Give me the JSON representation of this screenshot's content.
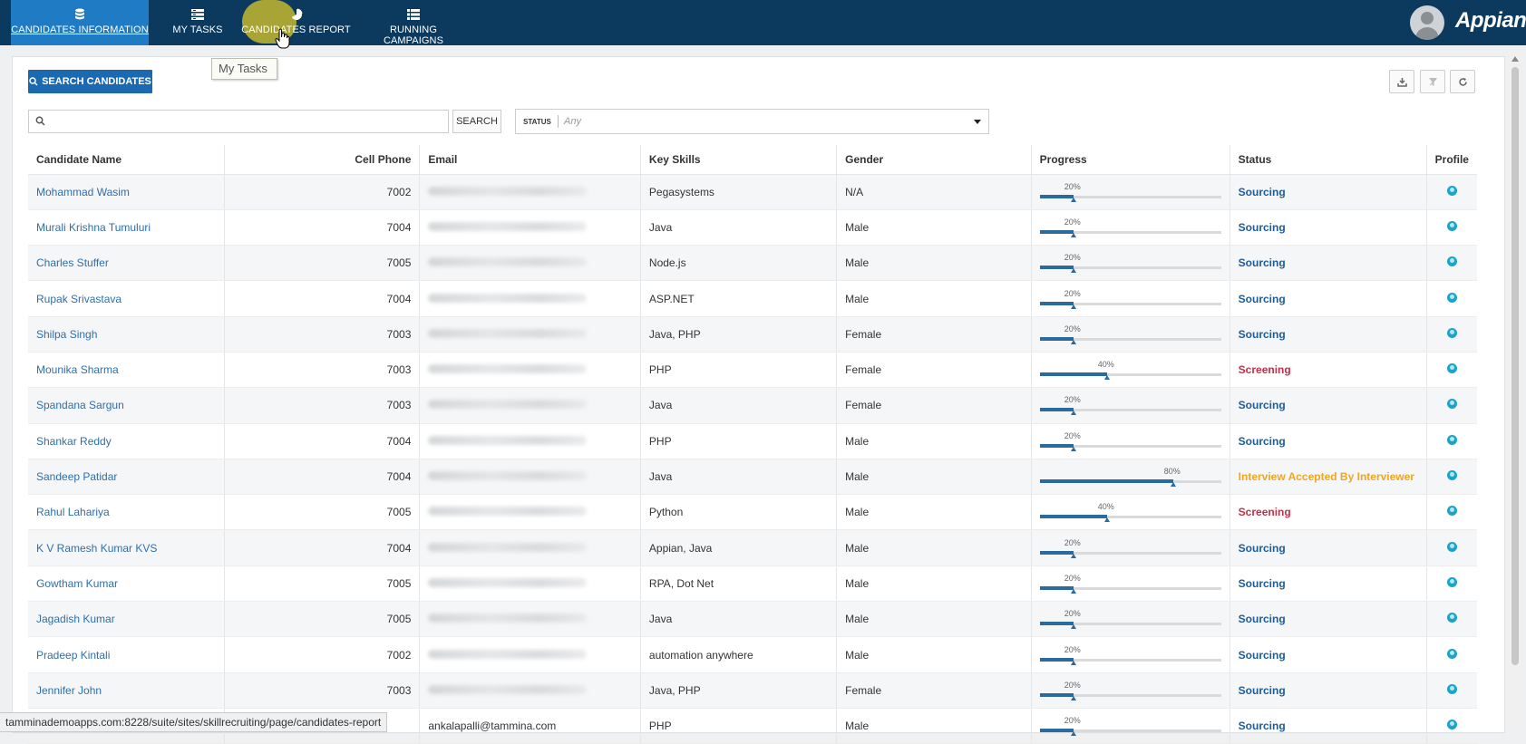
{
  "nav": {
    "tabs": [
      {
        "label": "CANDIDATES INFORMATION",
        "icon": "database-icon"
      },
      {
        "label": "MY TASKS",
        "icon": "tasks-icon"
      },
      {
        "label": "CANDIDATES REPORT",
        "icon": "pie-chart-icon"
      },
      {
        "label": "RUNNING CAMPAIGNS",
        "icon": "list-icon"
      }
    ],
    "brand": "Appian"
  },
  "tooltip": "My Tasks",
  "toolbar": {
    "search_candidates_label": "SEARCH CANDIDATES",
    "search_placeholder": "",
    "search_button_label": "SEARCH",
    "status_label": "STATUS",
    "status_value": "Any"
  },
  "table": {
    "headers": {
      "name": "Candidate Name",
      "phone": "Cell Phone",
      "email": "Email",
      "skills": "Key Skills",
      "gender": "Gender",
      "progress": "Progress",
      "status": "Status",
      "profile": "Profile"
    },
    "rows": [
      {
        "name": "Mohammad Wasim",
        "phone": "7002",
        "skills": "Pegasystems",
        "gender": "N/A",
        "progress": 20,
        "progress_label": "20%",
        "status": "Sourcing",
        "status_color": "#1d5c96"
      },
      {
        "name": "Murali Krishna Tumuluri",
        "phone": "7004",
        "skills": "Java",
        "gender": "Male",
        "progress": 20,
        "progress_label": "20%",
        "status": "Sourcing",
        "status_color": "#1d5c96"
      },
      {
        "name": "Charles Stuffer",
        "phone": "7005",
        "skills": "Node.js",
        "gender": "Male",
        "progress": 20,
        "progress_label": "20%",
        "status": "Sourcing",
        "status_color": "#1d5c96"
      },
      {
        "name": "Rupak Srivastava",
        "phone": "7004",
        "skills": "ASP.NET",
        "gender": "Male",
        "progress": 20,
        "progress_label": "20%",
        "status": "Sourcing",
        "status_color": "#1d5c96"
      },
      {
        "name": "Shilpa Singh",
        "phone": "7003",
        "skills": "Java, PHP",
        "gender": "Female",
        "progress": 20,
        "progress_label": "20%",
        "status": "Sourcing",
        "status_color": "#1d5c96"
      },
      {
        "name": "Mounika Sharma",
        "phone": "7003",
        "skills": "PHP",
        "gender": "Female",
        "progress": 40,
        "progress_label": "40%",
        "status": "Screening",
        "status_color": "#c2304a"
      },
      {
        "name": "Spandana Sargun",
        "phone": "7003",
        "skills": "Java",
        "gender": "Female",
        "progress": 20,
        "progress_label": "20%",
        "status": "Sourcing",
        "status_color": "#1d5c96"
      },
      {
        "name": "Shankar Reddy",
        "phone": "7004",
        "skills": "PHP",
        "gender": "Male",
        "progress": 20,
        "progress_label": "20%",
        "status": "Sourcing",
        "status_color": "#1d5c96"
      },
      {
        "name": "Sandeep Patidar",
        "phone": "7004",
        "skills": "Java",
        "gender": "Male",
        "progress": 80,
        "progress_label": "80%",
        "status": "Interview Accepted By Interviewer",
        "status_color": "#f0a524"
      },
      {
        "name": "Rahul Lahariya",
        "phone": "7005",
        "skills": "Python",
        "gender": "Male",
        "progress": 40,
        "progress_label": "40%",
        "status": "Screening",
        "status_color": "#c2304a"
      },
      {
        "name": "K V Ramesh Kumar KVS",
        "phone": "7004",
        "skills": "Appian, Java",
        "gender": "Male",
        "progress": 20,
        "progress_label": "20%",
        "status": "Sourcing",
        "status_color": "#1d5c96"
      },
      {
        "name": "Gowtham Kumar",
        "phone": "7005",
        "skills": "RPA, Dot Net",
        "gender": "Male",
        "progress": 20,
        "progress_label": "20%",
        "status": "Sourcing",
        "status_color": "#1d5c96"
      },
      {
        "name": "Jagadish Kumar",
        "phone": "7005",
        "skills": "Java",
        "gender": "Male",
        "progress": 20,
        "progress_label": "20%",
        "status": "Sourcing",
        "status_color": "#1d5c96"
      },
      {
        "name": "Pradeep Kintali",
        "phone": "7002",
        "skills": "automation anywhere",
        "gender": "Male",
        "progress": 20,
        "progress_label": "20%",
        "status": "Sourcing",
        "status_color": "#1d5c96"
      },
      {
        "name": "Jennifer John",
        "phone": "7003",
        "skills": "Java, PHP",
        "gender": "Female",
        "progress": 20,
        "progress_label": "20%",
        "status": "Sourcing",
        "status_color": "#1d5c96"
      },
      {
        "name": "",
        "phone": "",
        "email": "ankalapalli@tammina.com",
        "skills": "PHP",
        "gender": "Male",
        "progress": 20,
        "progress_label": "20%",
        "status": "Sourcing",
        "status_color": "#1d5c96"
      }
    ]
  },
  "statusbar": "tamminademoapps.com:8228/suite/sites/skillrecruiting/page/candidates-report"
}
